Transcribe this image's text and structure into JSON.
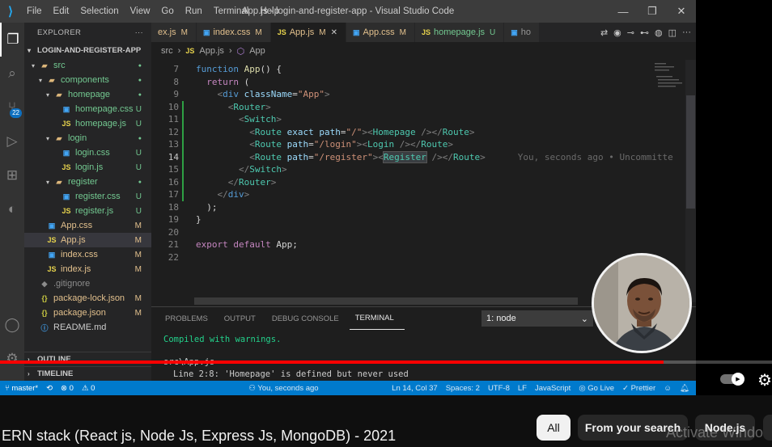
{
  "vscode": {
    "window_title": "App.js - login-and-register-app - Visual Studio Code",
    "menu": [
      "File",
      "Edit",
      "Selection",
      "View",
      "Go",
      "Run",
      "Terminal",
      "Help"
    ],
    "window_controls": [
      "—",
      "❐",
      "✕"
    ],
    "activity_badge": "22",
    "explorer": {
      "header": "EXPLORER",
      "more": "···",
      "project": "LOGIN-AND-REGISTER-APP",
      "items": [
        {
          "label": "src",
          "kind": "folder",
          "status": "●"
        },
        {
          "label": "components",
          "kind": "folder",
          "status": "●"
        },
        {
          "label": "homepage",
          "kind": "folder",
          "status": "●"
        },
        {
          "label": "homepage.css",
          "kind": "css",
          "status": "U"
        },
        {
          "label": "homepage.js",
          "kind": "js",
          "status": "U"
        },
        {
          "label": "login",
          "kind": "folder",
          "status": "●"
        },
        {
          "label": "login.css",
          "kind": "css",
          "status": "U"
        },
        {
          "label": "login.js",
          "kind": "js",
          "status": "U"
        },
        {
          "label": "register",
          "kind": "folder",
          "status": "●"
        },
        {
          "label": "register.css",
          "kind": "css",
          "status": "U"
        },
        {
          "label": "register.js",
          "kind": "js",
          "status": "U"
        },
        {
          "label": "App.css",
          "kind": "css",
          "status": "M"
        },
        {
          "label": "App.js",
          "kind": "js",
          "status": "M"
        },
        {
          "label": "index.css",
          "kind": "css",
          "status": "M"
        },
        {
          "label": "index.js",
          "kind": "js",
          "status": "M"
        },
        {
          "label": ".gitignore",
          "kind": "git",
          "status": ""
        },
        {
          "label": "package-lock.json",
          "kind": "json",
          "status": "M"
        },
        {
          "label": "package.json",
          "kind": "json",
          "status": "M"
        },
        {
          "label": "README.md",
          "kind": "md",
          "status": ""
        }
      ],
      "outline": "OUTLINE",
      "timeline": "TIMELINE"
    },
    "tabs": [
      {
        "label": "ex.js",
        "icon": "",
        "mark": "M",
        "active": false
      },
      {
        "label": "index.css",
        "icon": "CSS",
        "mark": "M",
        "active": false
      },
      {
        "label": "App.js",
        "icon": "JS",
        "mark": "M",
        "active": true
      },
      {
        "label": "App.css",
        "icon": "CSS",
        "mark": "M",
        "active": false
      },
      {
        "label": "homepage.js",
        "icon": "JS",
        "mark": "U",
        "active": false
      },
      {
        "label": "ho",
        "icon": "CSS",
        "mark": "",
        "active": false
      }
    ],
    "tab_close": "✕",
    "breadcrumb": {
      "folder": "src",
      "file": "App.js",
      "symbol": "App"
    },
    "code": {
      "line_numbers": [
        "7",
        "8",
        "9",
        "10",
        "11",
        "12",
        "13",
        "14",
        "15",
        "16",
        "17",
        "18",
        "19",
        "20",
        "21",
        "22"
      ],
      "current_line": "14",
      "blame": "You, seconds ago • Uncommitte"
    },
    "panel": {
      "tabs": [
        "PROBLEMS",
        "OUTPUT",
        "DEBUG CONSOLE",
        "TERMINAL"
      ],
      "active": "TERMINAL",
      "select": "1: node",
      "lines": [
        "Compiled with warnings.",
        "src\\App.js",
        "Line 2:8:  'Homepage' is defined but never used"
      ]
    },
    "status": {
      "branch": "master*",
      "sync": "⟲",
      "errors": "⊗ 0",
      "warnings": "⚠ 0",
      "blame": "You, seconds ago",
      "position": "Ln 14, Col 37",
      "spaces": "Spaces: 2",
      "encoding": "UTF-8",
      "eol": "LF",
      "language": "JavaScript",
      "golive": "Go Live",
      "prettier": "✓ Prettier"
    }
  },
  "youtube": {
    "progress": 0.86,
    "title": "ERN stack (React js, Node Js, Express Js, MongoDB) - 2021",
    "chips": [
      "All",
      "From your search",
      "Node.js"
    ],
    "watermark": "Activate Windo"
  },
  "colors": {
    "accent": "#007acc",
    "progress": "#ff0000"
  }
}
